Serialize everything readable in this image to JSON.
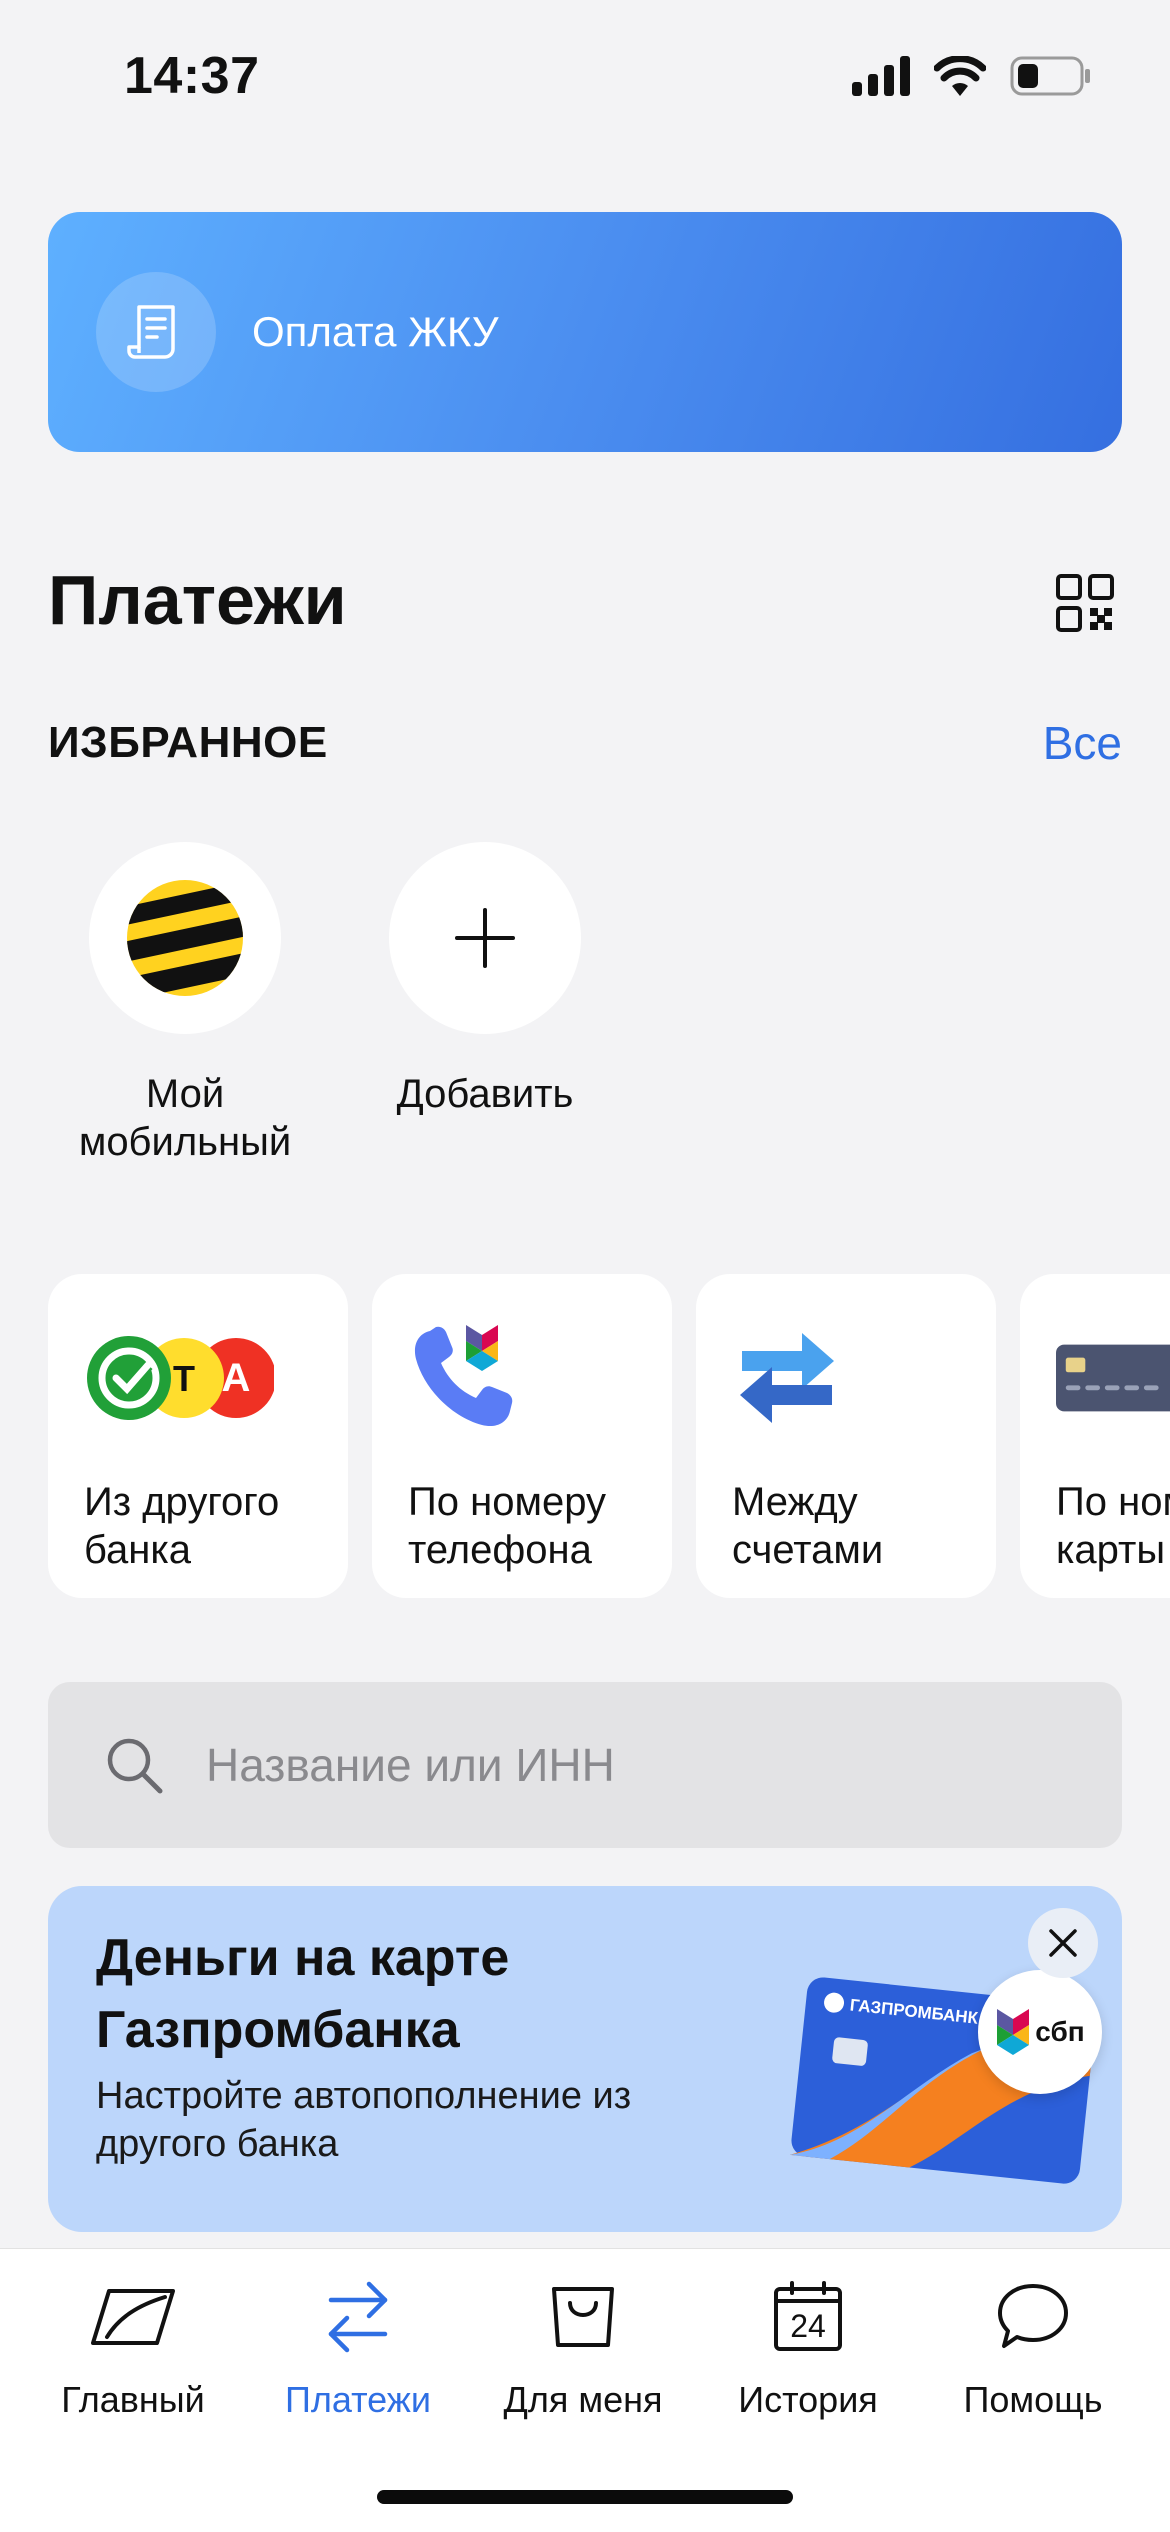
{
  "status_bar": {
    "time": "14:37"
  },
  "banner": {
    "label": "Оплата ЖКУ"
  },
  "page": {
    "title": "Платежи"
  },
  "favorites": {
    "title": "ИЗБРАННОЕ",
    "all_label": "Все",
    "items": [
      {
        "label": "Мой мобильный",
        "icon": "beeline-logo-icon"
      },
      {
        "label": "Добавить",
        "icon": "plus-icon"
      }
    ]
  },
  "payment_types": [
    {
      "line1": "Из другого",
      "line2": "банка",
      "icon": "bank-logos-icon"
    },
    {
      "line1": "По номеру",
      "line2": "телефона",
      "icon": "phone-sbp-icon"
    },
    {
      "line1": "Между",
      "line2": "счетами",
      "icon": "transfer-arrows-icon"
    },
    {
      "line1": "По номеру",
      "line2": "карты",
      "icon": "card-icon"
    }
  ],
  "search": {
    "placeholder": "Название или ИНН"
  },
  "promo": {
    "title": "Деньги на карте Газпромбанка",
    "text": "Настройте автопополнение из другого банка",
    "card_brand": "ГАЗПРОМБАНК",
    "sbp_label": "сбп"
  },
  "tabs": [
    {
      "label": "Главный",
      "icon": "home-logo-icon",
      "active": false
    },
    {
      "label": "Платежи",
      "icon": "transfer-icon",
      "active": true
    },
    {
      "label": "Для меня",
      "icon": "shopping-bag-icon",
      "active": false
    },
    {
      "label": "История",
      "icon": "calendar-icon",
      "calendar_number": "24",
      "active": false
    },
    {
      "label": "Помощь",
      "icon": "chat-bubble-icon",
      "active": false
    }
  ],
  "colors": {
    "accent": "#2f6fe3",
    "background": "#f3f3f5",
    "promo_bg": "#bcd6fb"
  }
}
